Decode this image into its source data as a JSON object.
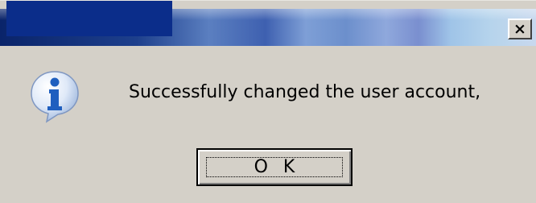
{
  "window": {
    "title": "",
    "close_label": "×"
  },
  "content": {
    "icon": "information-icon",
    "message": "Successfully changed the user account,"
  },
  "buttons": {
    "ok_label": "O K"
  },
  "colors": {
    "dialog_background": "#d4d0c8",
    "title_bar_dark": "#0b2d8a",
    "info_icon_blue": "#1f5fbf"
  }
}
